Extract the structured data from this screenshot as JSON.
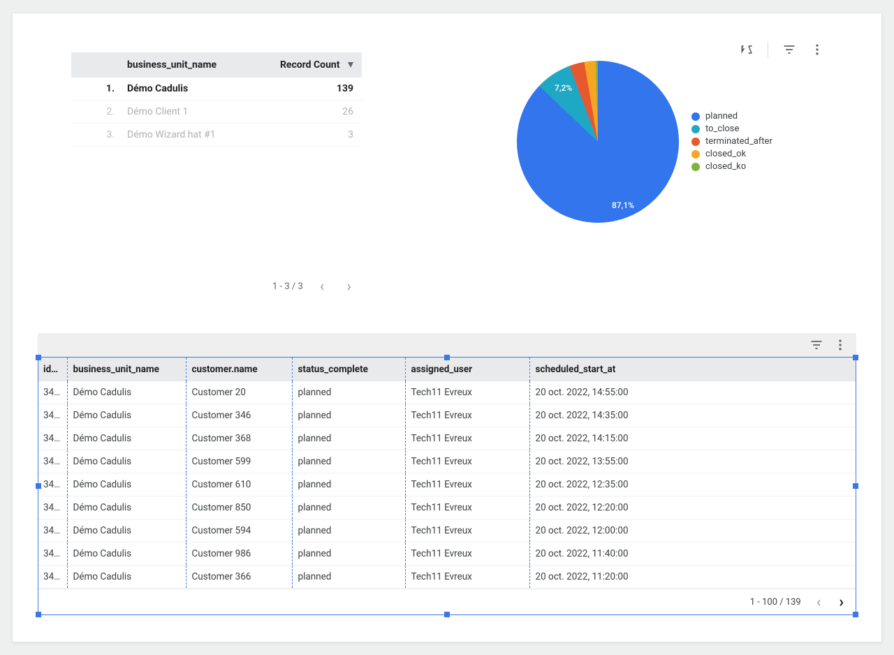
{
  "chart_data": {
    "type": "pie",
    "title": "",
    "series": [
      {
        "name": "planned",
        "value": 87.1,
        "color": "#3275ed"
      },
      {
        "name": "to_close",
        "value": 7.2,
        "color": "#1fa8c4"
      },
      {
        "name": "terminated_after",
        "value": 3.0,
        "color": "#e8582e"
      },
      {
        "name": "closed_ok",
        "value": 2.3,
        "color": "#f5a623"
      },
      {
        "name": "closed_ko",
        "value": 0.4,
        "color": "#7cb342"
      }
    ],
    "slice_labels": [
      "87,1%",
      "7,2%"
    ]
  },
  "small_table": {
    "headers": {
      "name": "business_unit_name",
      "count": "Record Count"
    },
    "rows": [
      {
        "idx": "1.",
        "name": "Démo Cadulis",
        "count": "139"
      },
      {
        "idx": "2.",
        "name": "Démo Client 1",
        "count": "26"
      },
      {
        "idx": "3.",
        "name": "Démo Wizard hat #1",
        "count": "3"
      }
    ],
    "pager": "1 - 3 / 3"
  },
  "big_table": {
    "headers": [
      "id…",
      "business_unit_name",
      "customer.name",
      "status_complete",
      "assigned_user",
      "scheduled_start_at"
    ],
    "rows": [
      {
        "id": "34…",
        "bu": "Démo Cadulis",
        "cust": "Customer 20",
        "status": "planned",
        "user": "Tech11 Evreux",
        "date": "20 oct. 2022, 14:55:00"
      },
      {
        "id": "34…",
        "bu": "Démo Cadulis",
        "cust": "Customer 346",
        "status": "planned",
        "user": "Tech11 Evreux",
        "date": "20 oct. 2022, 14:35:00"
      },
      {
        "id": "34…",
        "bu": "Démo Cadulis",
        "cust": "Customer 368",
        "status": "planned",
        "user": "Tech11 Evreux",
        "date": "20 oct. 2022, 14:15:00"
      },
      {
        "id": "34…",
        "bu": "Démo Cadulis",
        "cust": "Customer 599",
        "status": "planned",
        "user": "Tech11 Evreux",
        "date": "20 oct. 2022, 13:55:00"
      },
      {
        "id": "34…",
        "bu": "Démo Cadulis",
        "cust": "Customer 610",
        "status": "planned",
        "user": "Tech11 Evreux",
        "date": "20 oct. 2022, 12:35:00"
      },
      {
        "id": "34…",
        "bu": "Démo Cadulis",
        "cust": "Customer 850",
        "status": "planned",
        "user": "Tech11 Evreux",
        "date": "20 oct. 2022, 12:20:00"
      },
      {
        "id": "34…",
        "bu": "Démo Cadulis",
        "cust": "Customer 594",
        "status": "planned",
        "user": "Tech11 Evreux",
        "date": "20 oct. 2022, 12:00:00"
      },
      {
        "id": "34…",
        "bu": "Démo Cadulis",
        "cust": "Customer 986",
        "status": "planned",
        "user": "Tech11 Evreux",
        "date": "20 oct. 2022, 11:40:00"
      },
      {
        "id": "34…",
        "bu": "Démo Cadulis",
        "cust": "Customer 366",
        "status": "planned",
        "user": "Tech11 Evreux",
        "date": "20 oct. 2022, 11:20:00"
      }
    ],
    "pager": "1 - 100 / 139"
  }
}
